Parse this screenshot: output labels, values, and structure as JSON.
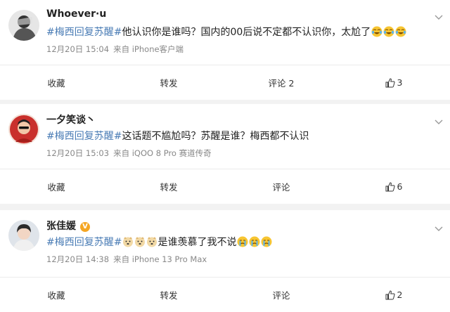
{
  "posts": [
    {
      "username": "Whoever·u",
      "verified": false,
      "hashtag": "#梅西回复苏醒#",
      "text": "他认识你是谁吗？国内的00后说不定都不认识你，太尬了",
      "emojis": [
        "laugh-cry-emoji",
        "laugh-cry-emoji",
        "laugh-cry-emoji"
      ],
      "date": "12月20日 15:04",
      "source": "来自 iPhone客户端",
      "favorite_label": "收藏",
      "repost_label": "转发",
      "comment_label": "评论 2",
      "like_count": "3"
    },
    {
      "username": "一夕笑谈丶",
      "verified": false,
      "hashtag": "#梅西回复苏醒#",
      "text": "这话题不尴尬吗？苏醒是谁？梅西都不认识",
      "emojis": [],
      "date": "12月20日 15:03",
      "source": "来自 iQOO 8 Pro 赛道传奇",
      "favorite_label": "收藏",
      "repost_label": "转发",
      "comment_label": "评论",
      "like_count": "6"
    },
    {
      "username": "张佳媛",
      "verified": true,
      "hashtag": "#梅西回复苏醒#",
      "lead_emojis": [
        "doge-emoji",
        "doge-emoji",
        "doge-emoji"
      ],
      "text": "是谁羡慕了我不说",
      "emojis": [
        "crying-emoji",
        "crying-emoji",
        "crying-emoji"
      ],
      "date": "12月20日 14:38",
      "source": "来自 iPhone 13 Pro Max",
      "favorite_label": "收藏",
      "repost_label": "转发",
      "comment_label": "评论",
      "like_count": "2"
    }
  ],
  "colors": {
    "hashtag": "#4a7cb5",
    "meta": "#888888",
    "background": "#f2f2f2"
  }
}
